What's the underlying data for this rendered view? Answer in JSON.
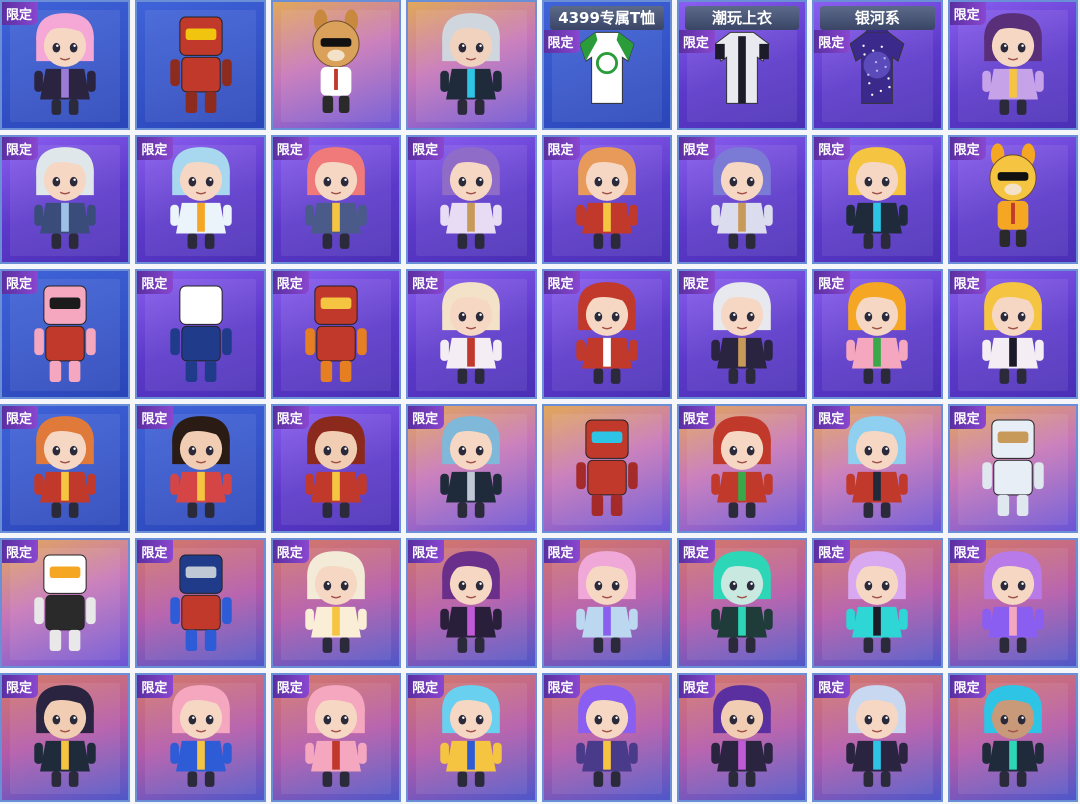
{
  "tag_label": "限定",
  "items": [
    {
      "theme": "blue",
      "tag": true,
      "banner": "",
      "kind": "character",
      "hair": "#f5a7d6",
      "skin": "#f6d7c3",
      "outfit": "#2a2440",
      "accent": "#9a7bd6"
    },
    {
      "theme": "blue",
      "tag": false,
      "banner": "",
      "kind": "robot",
      "hair": "#c0392b",
      "skin": "#8e2b1f",
      "outfit": "#c0392b",
      "accent": "#f1c40f"
    },
    {
      "theme": "gold",
      "tag": false,
      "banner": "",
      "kind": "animal",
      "hair": "#c8893f",
      "skin": "#d9a15a",
      "outfit": "#ffffff",
      "accent": "#c0392b"
    },
    {
      "theme": "gold",
      "tag": false,
      "banner": "",
      "kind": "character",
      "hair": "#cfd6de",
      "skin": "#f1d2bf",
      "outfit": "#1f2b3a",
      "accent": "#2ec4e6"
    },
    {
      "theme": "blue",
      "tag": true,
      "banner": "4399专属T恤",
      "kind": "shirt",
      "hair": "#ffffff",
      "skin": "#ffffff",
      "outfit": "#ffffff",
      "accent": "#2a9d3a"
    },
    {
      "theme": "purple",
      "tag": true,
      "banner": "潮玩上衣",
      "kind": "jacket",
      "hair": "#ffffff",
      "skin": "#ffffff",
      "outfit": "#e8eaf0",
      "accent": "#1b1b2a"
    },
    {
      "theme": "purple",
      "tag": true,
      "banner": "银河系",
      "kind": "hoodie",
      "hair": "#3b2a8c",
      "skin": "#3b2a8c",
      "outfit": "#3b2a8c",
      "accent": "#7c6ae8"
    },
    {
      "theme": "purple",
      "tag": true,
      "banner": "",
      "kind": "character",
      "hair": "#5a2f7a",
      "skin": "#f6d7c3",
      "outfit": "#c6a2e8",
      "accent": "#f5c542"
    },
    {
      "theme": "purple",
      "tag": true,
      "banner": "",
      "kind": "character",
      "hair": "#dfe7ea",
      "skin": "#f6d7c3",
      "outfit": "#3a4d7a",
      "accent": "#9fc1e8"
    },
    {
      "theme": "purple",
      "tag": true,
      "banner": "",
      "kind": "character",
      "hair": "#a8d8f0",
      "skin": "#f6d7c3",
      "outfit": "#eaf4fa",
      "accent": "#f5a623"
    },
    {
      "theme": "purple",
      "tag": true,
      "banner": "",
      "kind": "character",
      "hair": "#f07a7a",
      "skin": "#f6d7c3",
      "outfit": "#4a5b8a",
      "accent": "#f5c542"
    },
    {
      "theme": "purple",
      "tag": true,
      "banner": "",
      "kind": "character",
      "hair": "#8e6cc8",
      "skin": "#f6d7c3",
      "outfit": "#e8dcf5",
      "accent": "#c89a5a"
    },
    {
      "theme": "purple",
      "tag": true,
      "banner": "",
      "kind": "character",
      "hair": "#e89a5a",
      "skin": "#f6d7c3",
      "outfit": "#c0392b",
      "accent": "#f5c542"
    },
    {
      "theme": "purple",
      "tag": true,
      "banner": "",
      "kind": "character",
      "hair": "#7b7bd6",
      "skin": "#f6d7c3",
      "outfit": "#dcdcef",
      "accent": "#c89a5a"
    },
    {
      "theme": "purple",
      "tag": true,
      "banner": "",
      "kind": "character",
      "hair": "#f5c542",
      "skin": "#f6d7c3",
      "outfit": "#1f2b3a",
      "accent": "#2ec4e6"
    },
    {
      "theme": "purple",
      "tag": true,
      "banner": "",
      "kind": "animal",
      "hair": "#f5a623",
      "skin": "#f5c542",
      "outfit": "#f5a623",
      "accent": "#c0392b"
    },
    {
      "theme": "blue",
      "tag": true,
      "banner": "",
      "kind": "robot",
      "hair": "#f5a7c0",
      "skin": "#f5a7c0",
      "outfit": "#c0392b",
      "accent": "#1b1b1b"
    },
    {
      "theme": "purple",
      "tag": true,
      "banner": "",
      "kind": "robot",
      "hair": "#ffffff",
      "skin": "#1f3b8a",
      "outfit": "#1f3b8a",
      "accent": "#ffffff"
    },
    {
      "theme": "purple",
      "tag": true,
      "banner": "",
      "kind": "robot",
      "hair": "#c0392b",
      "skin": "#e67e22",
      "outfit": "#c0392b",
      "accent": "#f5c542"
    },
    {
      "theme": "purple",
      "tag": true,
      "banner": "",
      "kind": "character",
      "hair": "#f3e2c8",
      "skin": "#f6d7c3",
      "outfit": "#f4eef4",
      "accent": "#c0392b"
    },
    {
      "theme": "purple",
      "tag": true,
      "banner": "",
      "kind": "character",
      "hair": "#c0392b",
      "skin": "#f6d7c3",
      "outfit": "#c0392b",
      "accent": "#ffffff"
    },
    {
      "theme": "purple",
      "tag": true,
      "banner": "",
      "kind": "character",
      "hair": "#e8e8ef",
      "skin": "#f6d7c3",
      "outfit": "#2a2440",
      "accent": "#c89a5a"
    },
    {
      "theme": "purple",
      "tag": true,
      "banner": "",
      "kind": "character",
      "hair": "#f5a623",
      "skin": "#f6d7c3",
      "outfit": "#f5a7c0",
      "accent": "#3aa84a"
    },
    {
      "theme": "purple",
      "tag": true,
      "banner": "",
      "kind": "character",
      "hair": "#f5c542",
      "skin": "#f6d7c3",
      "outfit": "#f4eef4",
      "accent": "#1b1b2a"
    },
    {
      "theme": "blue",
      "tag": true,
      "banner": "",
      "kind": "character",
      "hair": "#e07a3a",
      "skin": "#f6d7c3",
      "outfit": "#c0392b",
      "accent": "#f5c542"
    },
    {
      "theme": "blue",
      "tag": true,
      "banner": "",
      "kind": "character",
      "hair": "#2a1b14",
      "skin": "#f1cdb3",
      "outfit": "#d64545",
      "accent": "#f5c542"
    },
    {
      "theme": "purple",
      "tag": true,
      "banner": "",
      "kind": "character",
      "hair": "#8b2a1c",
      "skin": "#f1cdb3",
      "outfit": "#c0392b",
      "accent": "#f5c542"
    },
    {
      "theme": "gold",
      "tag": true,
      "banner": "",
      "kind": "character",
      "hair": "#7fb8d8",
      "skin": "#f6d7c3",
      "outfit": "#1f2b3a",
      "accent": "#c0c8d6"
    },
    {
      "theme": "gold",
      "tag": false,
      "banner": "",
      "kind": "robot",
      "hair": "#c0392b",
      "skin": "#a52a2a",
      "outfit": "#c0392b",
      "accent": "#2ec4e6"
    },
    {
      "theme": "gold",
      "tag": true,
      "banner": "",
      "kind": "character",
      "hair": "#c0392b",
      "skin": "#f6d7c3",
      "outfit": "#c0392b",
      "accent": "#3aa84a"
    },
    {
      "theme": "gold",
      "tag": true,
      "banner": "",
      "kind": "character",
      "hair": "#8fd0f0",
      "skin": "#f6d7c3",
      "outfit": "#c0392b",
      "accent": "#1f2b3a"
    },
    {
      "theme": "gold",
      "tag": true,
      "banner": "",
      "kind": "robot",
      "hair": "#e8eef5",
      "skin": "#dfe7ef",
      "outfit": "#e8eef5",
      "accent": "#c89a5a"
    },
    {
      "theme": "gold",
      "tag": true,
      "banner": "",
      "kind": "robot",
      "hair": "#ffffff",
      "skin": "#e8e8e8",
      "outfit": "#2a2a2a",
      "accent": "#f5a623"
    },
    {
      "theme": "sunset",
      "tag": true,
      "banner": "",
      "kind": "robot",
      "hair": "#1f3b8a",
      "skin": "#2e5bd6",
      "outfit": "#c0392b",
      "accent": "#c0c8d6"
    },
    {
      "theme": "sunset",
      "tag": true,
      "banner": "",
      "kind": "character",
      "hair": "#f3ead8",
      "skin": "#f6d7c3",
      "outfit": "#fbeed7",
      "accent": "#f5c542"
    },
    {
      "theme": "sunset",
      "tag": true,
      "banner": "",
      "kind": "character",
      "hair": "#6a2f8a",
      "skin": "#f6d7c3",
      "outfit": "#2a1f3a",
      "accent": "#c05ad6"
    },
    {
      "theme": "sunset",
      "tag": true,
      "banner": "",
      "kind": "character",
      "hair": "#f0a8d8",
      "skin": "#f6d7c3",
      "outfit": "#bcd8f0",
      "accent": "#8a5ef0"
    },
    {
      "theme": "sunset",
      "tag": true,
      "banner": "",
      "kind": "character",
      "hair": "#2ed6b8",
      "skin": "#c8e8e0",
      "outfit": "#1f3b3a",
      "accent": "#2ed6b8"
    },
    {
      "theme": "sunset",
      "tag": true,
      "banner": "",
      "kind": "character",
      "hair": "#d8a8f0",
      "skin": "#f6d7c3",
      "outfit": "#2ed6d6",
      "accent": "#1b1b2a"
    },
    {
      "theme": "sunset",
      "tag": true,
      "banner": "",
      "kind": "character",
      "hair": "#b87ae8",
      "skin": "#f6d7c3",
      "outfit": "#8a5ef0",
      "accent": "#f5a7c0"
    },
    {
      "theme": "sunset",
      "tag": true,
      "banner": "",
      "kind": "character",
      "hair": "#2a2440",
      "skin": "#f1cdb3",
      "outfit": "#1f2b3a",
      "accent": "#f5c542"
    },
    {
      "theme": "sunset",
      "tag": true,
      "banner": "",
      "kind": "character",
      "hair": "#f5a7c0",
      "skin": "#f6d7c3",
      "outfit": "#2e5bd6",
      "accent": "#f5c542"
    },
    {
      "theme": "sunset",
      "tag": true,
      "banner": "",
      "kind": "character",
      "hair": "#f5a7c0",
      "skin": "#f6d7c3",
      "outfit": "#f5a7c0",
      "accent": "#c0392b"
    },
    {
      "theme": "sunset",
      "tag": true,
      "banner": "",
      "kind": "character",
      "hair": "#6ad0f0",
      "skin": "#f6d7c3",
      "outfit": "#f5c542",
      "accent": "#2e5bd6"
    },
    {
      "theme": "sunset",
      "tag": true,
      "banner": "",
      "kind": "character",
      "hair": "#8a5ef0",
      "skin": "#f6d7c3",
      "outfit": "#4a3a8a",
      "accent": "#f5c542"
    },
    {
      "theme": "sunset",
      "tag": true,
      "banner": "",
      "kind": "character",
      "hair": "#5a2fa0",
      "skin": "#f1cdb3",
      "outfit": "#2a2440",
      "accent": "#c05ad6"
    },
    {
      "theme": "sunset",
      "tag": true,
      "banner": "",
      "kind": "character",
      "hair": "#c8d8f0",
      "skin": "#f6d7c3",
      "outfit": "#2a2440",
      "accent": "#2ec4e6"
    },
    {
      "theme": "sunset",
      "tag": true,
      "banner": "",
      "kind": "character",
      "hair": "#2ec4e6",
      "skin": "#c89a7a",
      "outfit": "#1f2b3a",
      "accent": "#2ed6b8"
    }
  ]
}
